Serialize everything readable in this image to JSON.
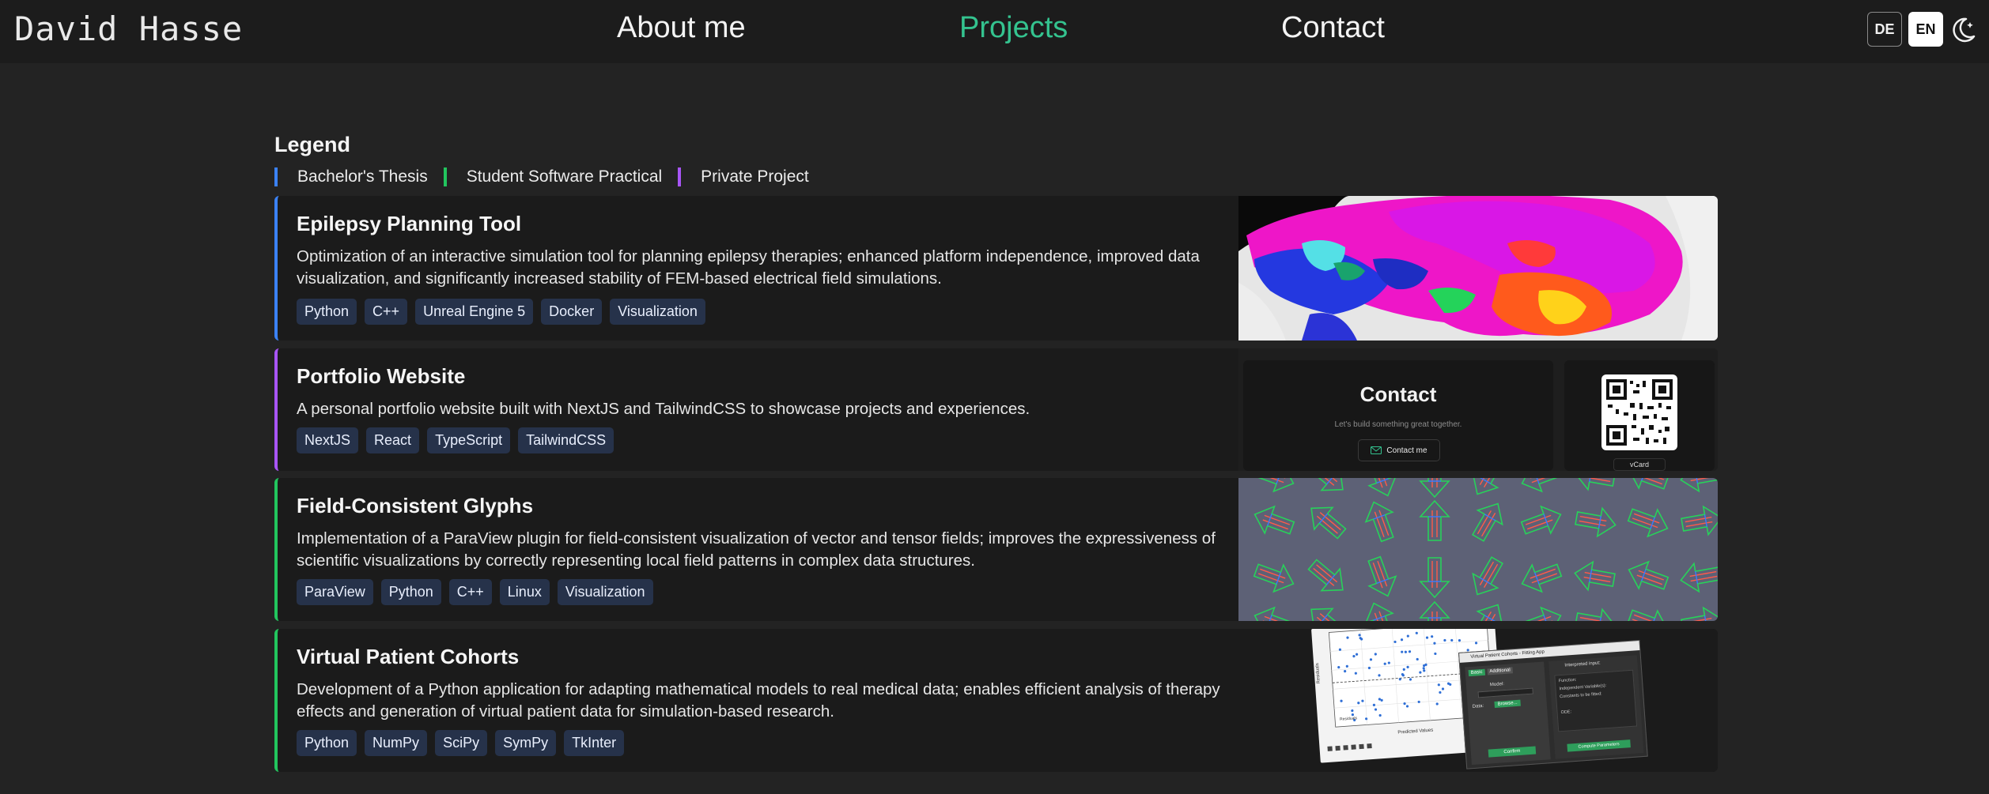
{
  "nav": {
    "logo": "David Hasse",
    "links": [
      {
        "label": "About me",
        "active": false
      },
      {
        "label": "Projects",
        "active": true
      },
      {
        "label": "Contact",
        "active": false
      }
    ],
    "languages": [
      {
        "label": "DE",
        "selected": false
      },
      {
        "label": "EN",
        "selected": true
      }
    ],
    "theme_icon": "moon-star-icon",
    "accent_color": "#34c38f"
  },
  "legend": {
    "title": "Legend",
    "items": [
      {
        "label": "Bachelor's Thesis",
        "color": "#3b82f6"
      },
      {
        "label": "Student Software Practical",
        "color": "#22c55e"
      },
      {
        "label": "Private Project",
        "color": "#a855f7"
      }
    ]
  },
  "projects": [
    {
      "title": "Epilepsy Planning Tool",
      "description": "Optimization of an interactive simulation tool for planning epilepsy therapies; enhanced platform independence, improved data visualization, and significantly increased stability of FEM-based electrical field simulations.",
      "tags": [
        "Python",
        "C++",
        "Unreal Engine 5",
        "Docker",
        "Visualization"
      ],
      "category_color": "#3b82f6"
    },
    {
      "title": "Portfolio Website",
      "description": "A personal portfolio website built with NextJS and TailwindCSS to showcase projects and experiences.",
      "tags": [
        "NextJS",
        "React",
        "TypeScript",
        "TailwindCSS"
      ],
      "category_color": "#a855f7",
      "preview": {
        "heading": "Contact",
        "subtext": "Let's build something great together.",
        "button": "Contact me",
        "vcard": "vCard"
      }
    },
    {
      "title": "Field-Consistent Glyphs",
      "description": "Implementation of a ParaView plugin for field-consistent visualization of vector and tensor fields; improves the expressiveness of scientific visualizations by correctly representing local field patterns in complex data structures.",
      "tags": [
        "ParaView",
        "Python",
        "C++",
        "Linux",
        "Visualization"
      ],
      "category_color": "#22c55e"
    },
    {
      "title": "Virtual Patient Cohorts",
      "description": "Development of a Python application for adapting mathematical models to real medical data; enables efficient analysis of therapy effects and generation of virtual patient data for simulation-based research.",
      "tags": [
        "Python",
        "NumPy",
        "SciPy",
        "SymPy",
        "TkInter"
      ],
      "category_color": "#22c55e",
      "preview": {
        "window_title": "Virtual Patient Cohorts - Fitting App",
        "tab_basic": "Basic",
        "tab_additional": "Additional",
        "model_label": "Model:",
        "data_label": "Data:",
        "browse": "Browse...",
        "confirm": "Confirm",
        "interpreted": "Interpreted input:",
        "function": "Function:",
        "independent": "Independent Variable(s):",
        "constants": "Constants to be fitted:",
        "ode": "ODE:",
        "compute": "Compute Parameters",
        "plot_ylabel": "Residuals",
        "plot_xlabel": "Predicted Values",
        "plot_legend": "Residuals"
      }
    }
  ]
}
